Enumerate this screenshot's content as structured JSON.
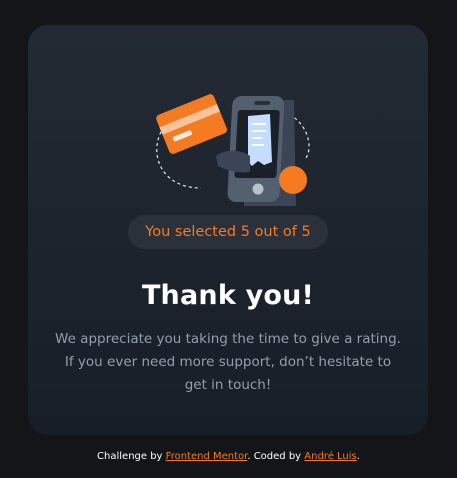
{
  "card": {
    "illustration": "phone-payment-receipt-illustration",
    "selection_text": "You selected 5 out of 5",
    "title": "Thank you!",
    "message": "We appreciate you taking the time to give a rating. If you ever need more support, don’t hesitate to get in touch!",
    "rating": 5,
    "rating_max": 5
  },
  "attribution": {
    "prefix": "Challenge by",
    "link1": "Frontend Mentor",
    "middle": ". Coded by",
    "link2": "André Luis",
    "suffix": "."
  },
  "colors": {
    "background": "#131518",
    "card": "#1f2630",
    "accent": "#f47b22",
    "badge_bg": "#2a313b",
    "body_text": "#959eac",
    "title": "#ffffff"
  }
}
